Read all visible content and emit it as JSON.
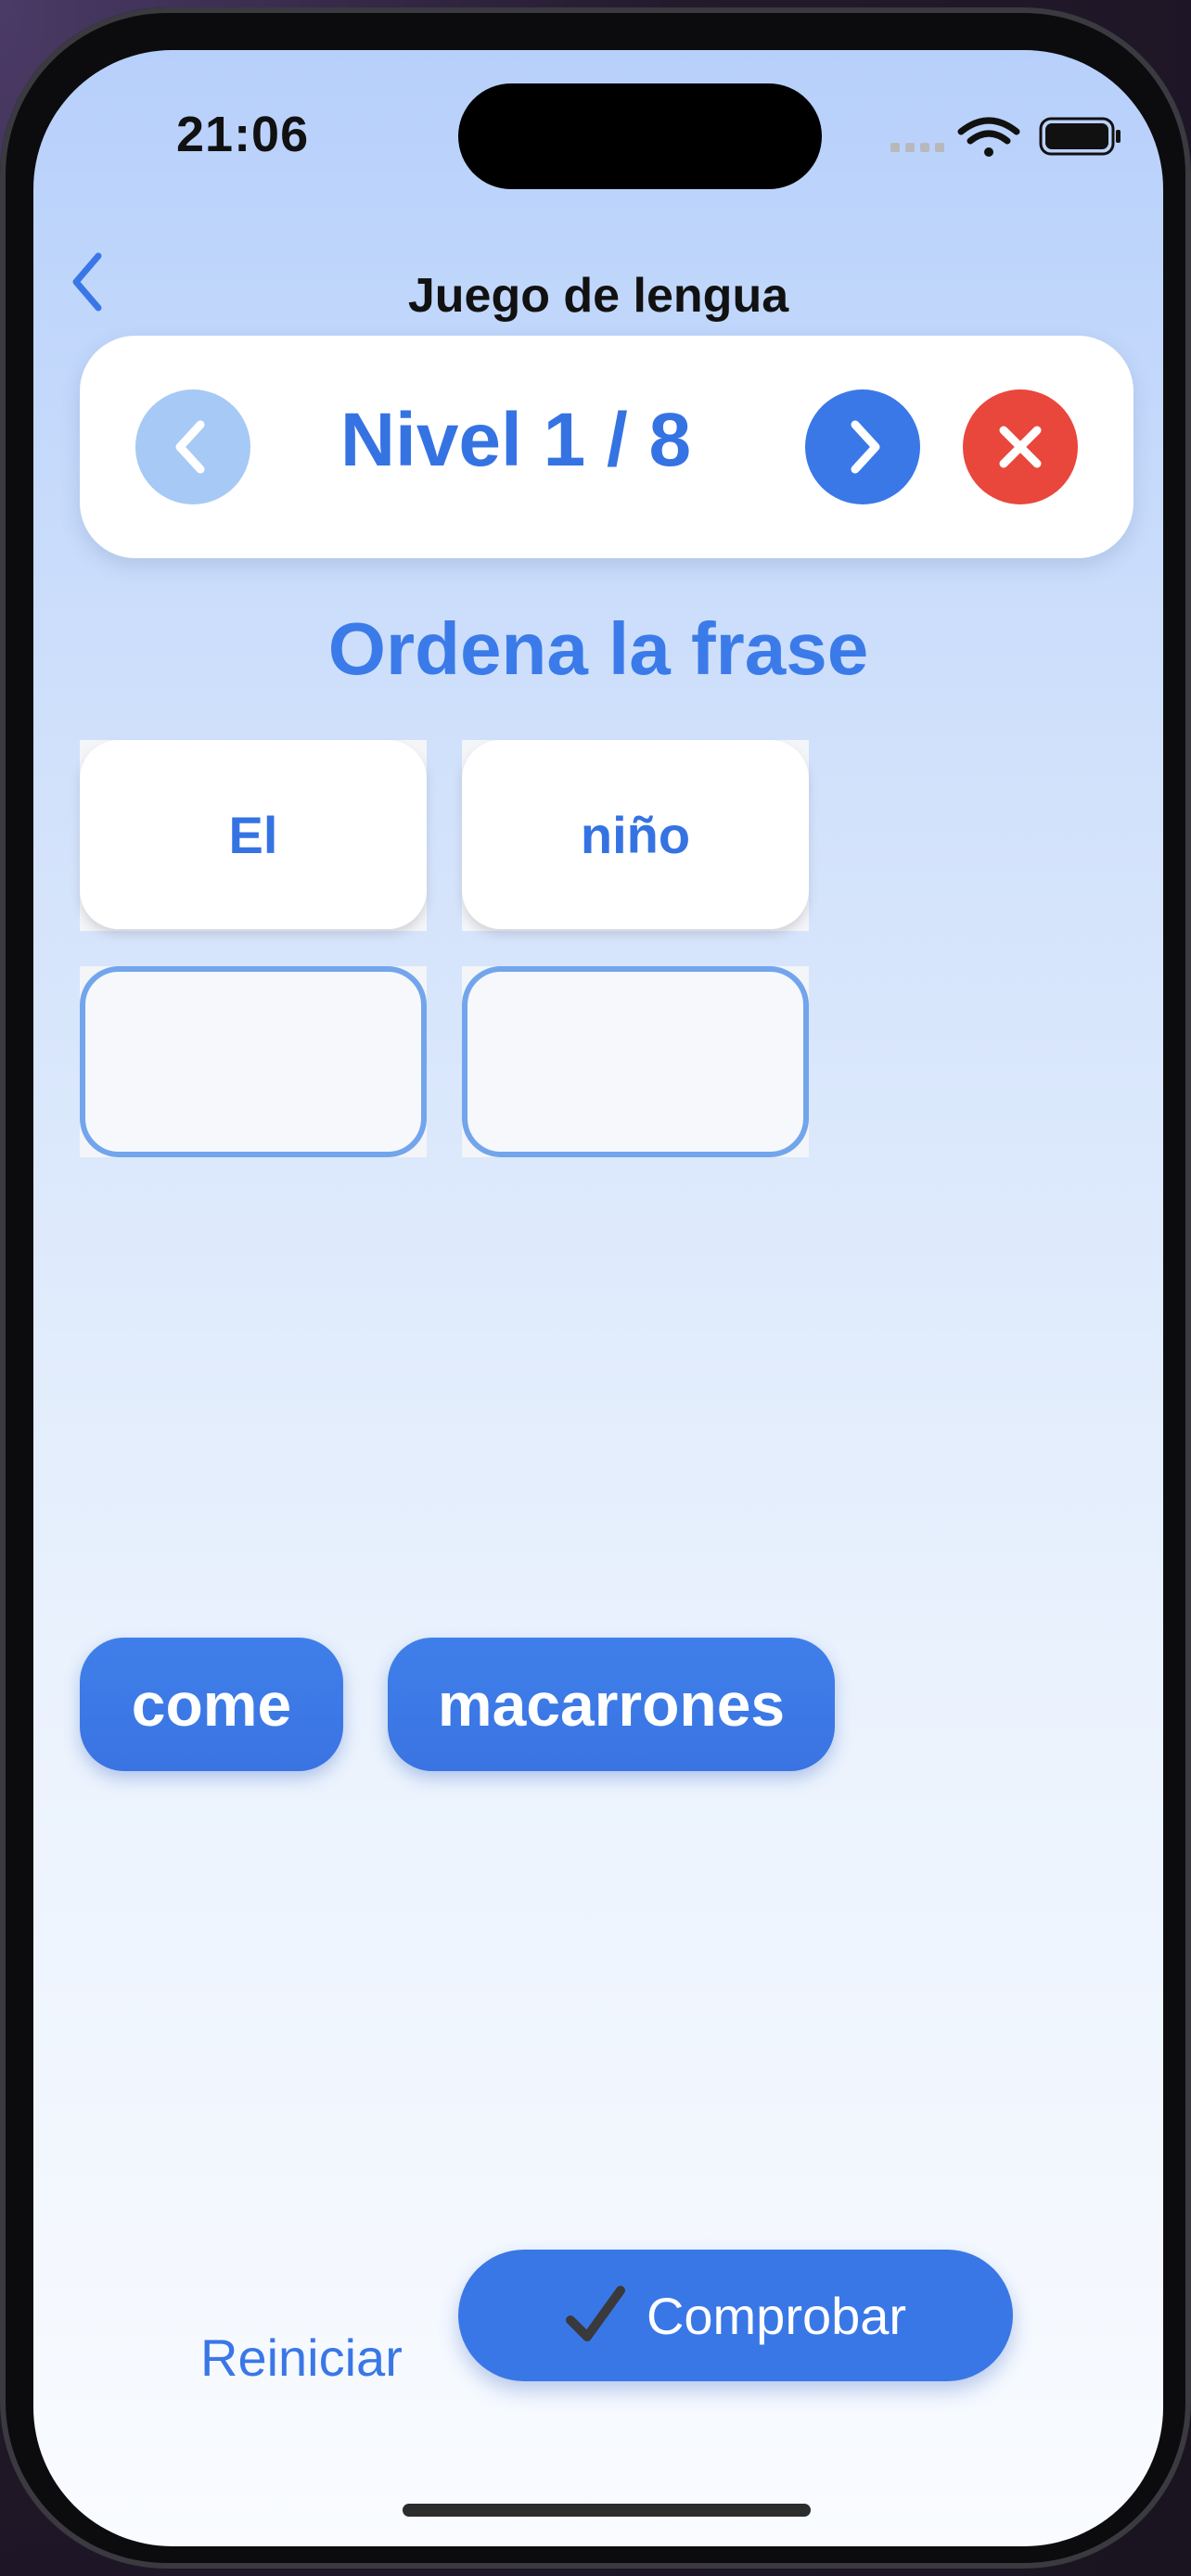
{
  "status_bar": {
    "time": "21:06"
  },
  "nav": {
    "title": "Juego de lengua"
  },
  "level_bar": {
    "label": "Nivel 1 / 8"
  },
  "instruction": "Ordena la frase",
  "answer_slots": [
    {
      "word": "El"
    },
    {
      "word": "niño"
    },
    {
      "word": ""
    },
    {
      "word": ""
    }
  ],
  "word_bank": [
    {
      "word": "come"
    },
    {
      "word": "macarrones"
    }
  ],
  "actions": {
    "reset_label": "Reiniciar",
    "check_label": "Comprobar"
  },
  "colors": {
    "accent": "#3a77e6",
    "prev_button": "#a7c9f5",
    "close_button": "#e9473c",
    "slot_border": "#72a5ec"
  },
  "icons": {
    "back": "chevron-left-icon",
    "prev": "chevron-left-icon",
    "next": "chevron-right-icon",
    "close": "close-icon",
    "check": "checkmark-icon",
    "status": [
      "signal-icon",
      "wifi-icon",
      "battery-icon"
    ]
  }
}
